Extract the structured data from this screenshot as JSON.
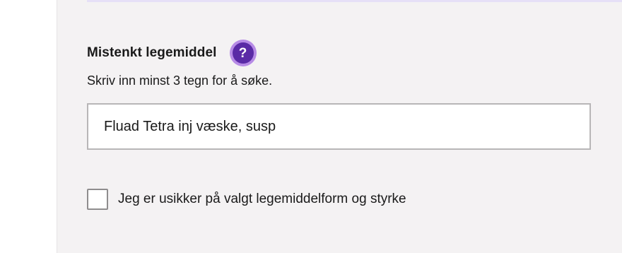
{
  "field": {
    "label": "Mistenkt legemiddel",
    "help_icon": "?",
    "hint": "Skriv inn minst 3 tegn for å søke.",
    "input_value": "Fluad Tetra inj væske, susp"
  },
  "checkbox": {
    "label": "Jeg er usikker på valgt legemiddelform og styrke",
    "checked": false
  },
  "colors": {
    "panel_bg": "#f4f2f3",
    "help_outer": "#b78be6",
    "help_inner": "#5a2aa6",
    "input_border": "#b8b6b7",
    "top_strip": "#e6e0f7"
  }
}
